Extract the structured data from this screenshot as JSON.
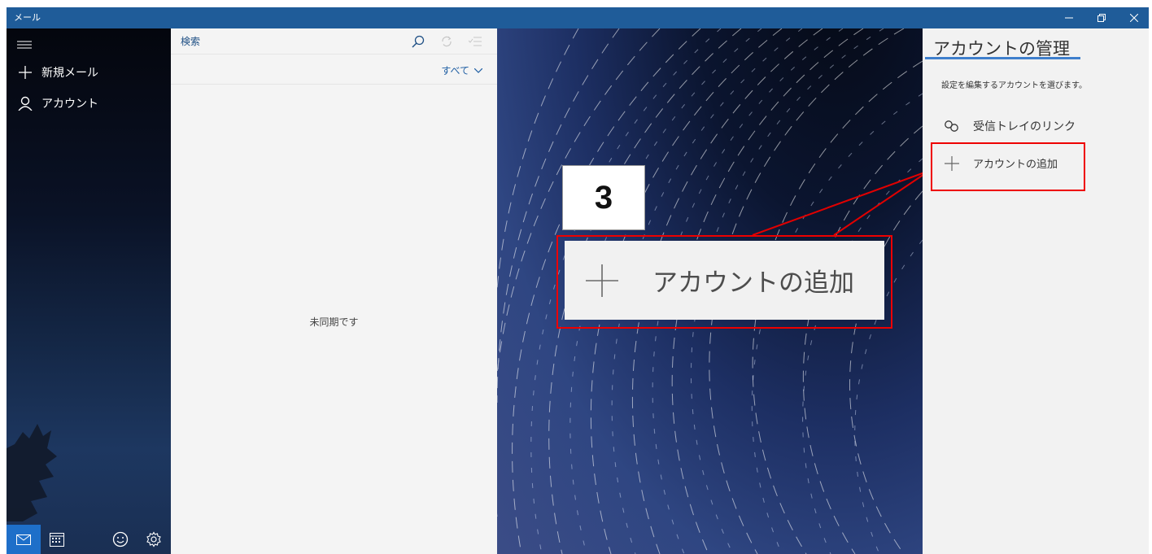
{
  "window": {
    "title": "メール"
  },
  "nav": {
    "new_mail": "新規メール",
    "account": "アカウント"
  },
  "list": {
    "search_placeholder": "検索",
    "filter_label": "すべて",
    "empty_text": "未同期です"
  },
  "annotation": {
    "step_number": "3",
    "zoom_label": "アカウントの追加"
  },
  "flyout": {
    "title": "アカウントの管理",
    "description": "設定を編集するアカウントを選びます。",
    "items": [
      {
        "label": "受信トレイのリンク",
        "icon": "link-icon"
      },
      {
        "label": "アカウントの追加",
        "icon": "plus-icon"
      }
    ]
  },
  "colors": {
    "titlebar": "#1f5c99",
    "accent": "#1e6fc9",
    "annotation_red": "#e00000",
    "flyout_underline": "#3f7fcc"
  }
}
